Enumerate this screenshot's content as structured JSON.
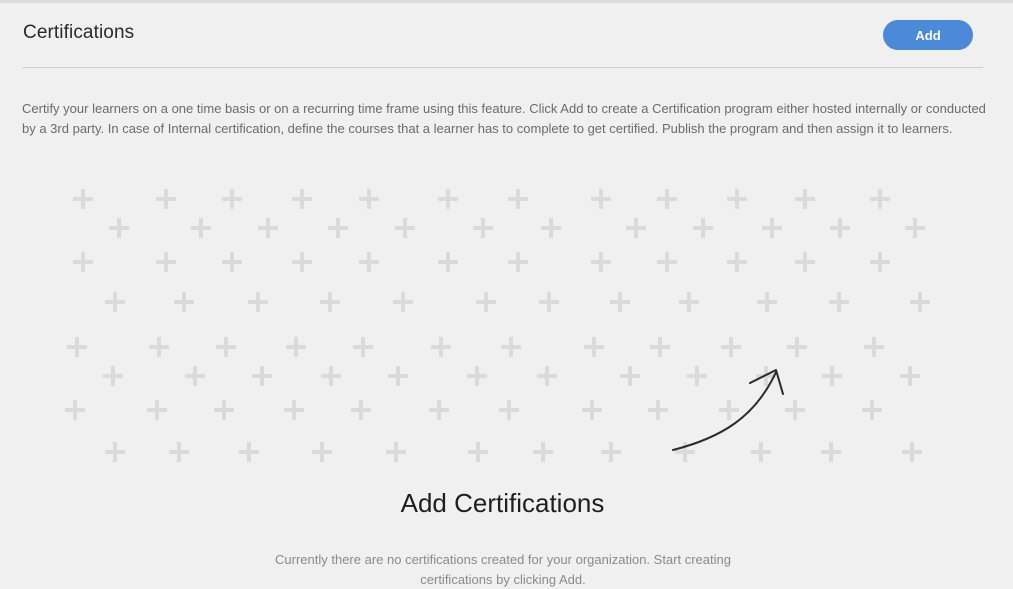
{
  "header": {
    "title": "Certifications",
    "add_label": "Add"
  },
  "description": "Certify your learners on a one time basis or on a recurring time frame using this feature. Click Add to create a Certification program either hosted internally or conducted by a 3rd party. In case of Internal certification, define the courses that a learner has to complete to get certified. Publish the program and then assign it to learners.",
  "empty_state": {
    "title": "Add Certifications",
    "message": "Currently there are no certifications created for your organization. Start creating certifications by clicking Add.",
    "illustration_icon": "plus-icon",
    "pointer_icon": "curved-arrow-icon"
  },
  "colors": {
    "accent": "#4a8ad8",
    "background": "#f0f0f0",
    "plus": "#dadada"
  }
}
